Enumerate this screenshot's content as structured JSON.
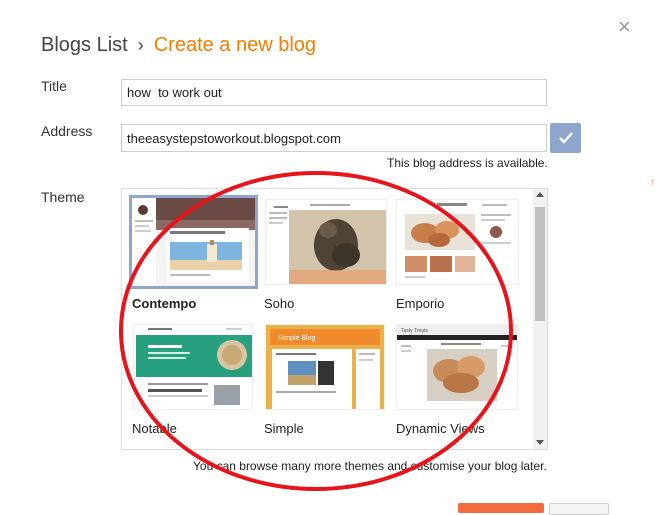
{
  "dialog": {
    "close_glyph": "×"
  },
  "breadcrumb": {
    "root": "Blogs List",
    "separator": "›",
    "current": "Create a new blog"
  },
  "form": {
    "title_label": "Title",
    "title_value": "how  to work out",
    "address_label": "Address",
    "address_value": "theeasystepstoworkout.blogspot.com",
    "availability": "This blog address is available.",
    "theme_label": "Theme"
  },
  "themes": [
    {
      "name": "Contempo",
      "selected": true,
      "preview_caption": "Elio and Their"
    },
    {
      "name": "Soho",
      "selected": false,
      "preview_caption": ""
    },
    {
      "name": "Emporio",
      "selected": false,
      "preview_caption": "Tasty Treats"
    },
    {
      "name": "Notable",
      "selected": false,
      "preview_caption": "Social Media \"Friends\""
    },
    {
      "name": "Simple",
      "selected": false,
      "preview_caption": "Simple Blog"
    },
    {
      "name": "Dynamic Views",
      "selected": false,
      "preview_caption": "Tasty Treats"
    }
  ],
  "hint": "You can browse many more themes and customise your blog later.",
  "colors": {
    "accent": "#f57d00",
    "selection": "#8fa5cc",
    "annotation_ring": "#e8141c"
  }
}
